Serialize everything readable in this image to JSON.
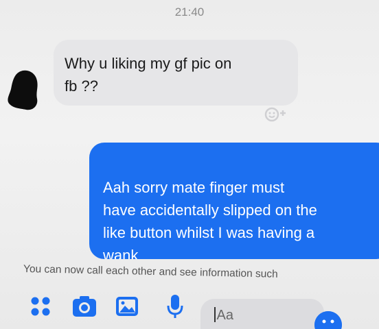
{
  "header": {
    "timestamp": "21:40"
  },
  "thread": {
    "incoming": {
      "text": "Why u liking my gf pic on\nfb ??"
    },
    "outgoing": {
      "text": "Aah sorry mate finger must\nhave accidentally slipped on the\nlike button whilst I was having a\nwank"
    }
  },
  "notice": {
    "text": "You can now call each other and see information such"
  },
  "composer": {
    "placeholder": "Aa"
  },
  "icons": {
    "apps": "four-dots-icon",
    "camera": "camera-icon",
    "gallery": "image-icon",
    "mic": "microphone-icon",
    "emoji": "emoji-icon",
    "react": "add-reaction-icon"
  },
  "colors": {
    "accent": "#1c6ff0",
    "incoming_bubble": "#e6e6e8",
    "background": "#ececec"
  }
}
